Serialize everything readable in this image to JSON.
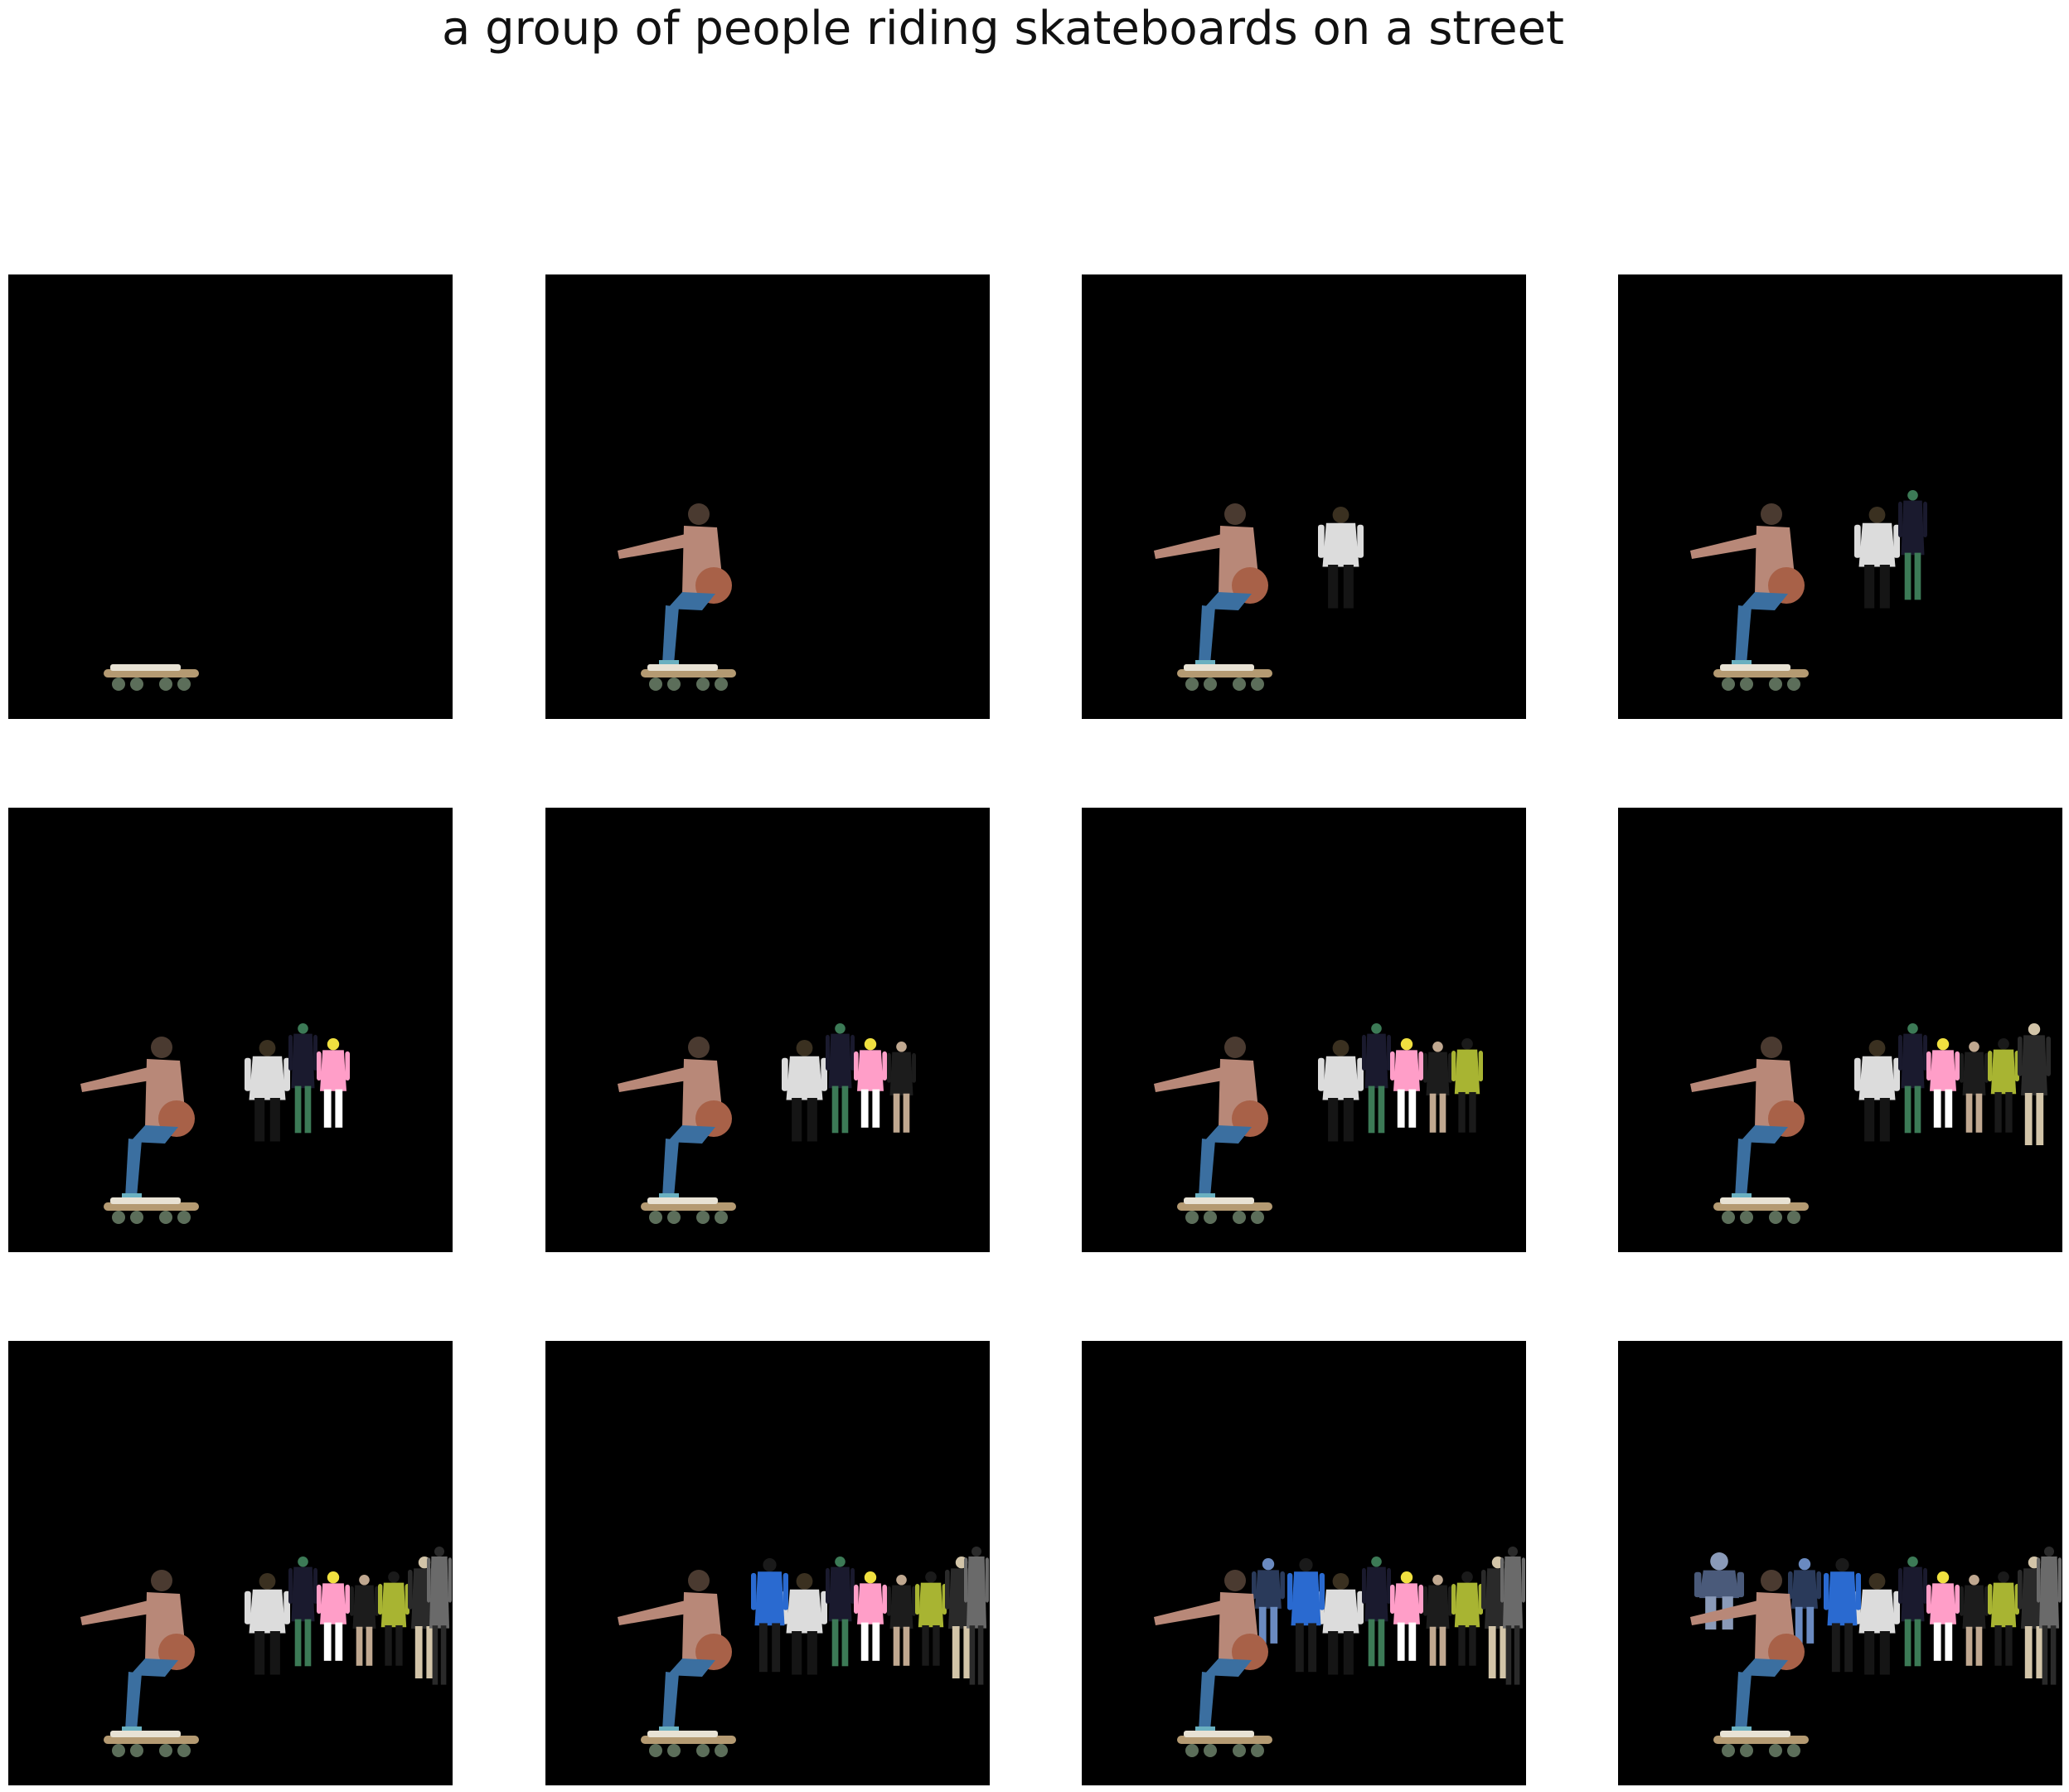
{
  "title": "a group of people riding skateboards on a street",
  "grid": {
    "rows": 3,
    "cols": 4
  },
  "frames": [
    {
      "step": 1,
      "visible_objects": 1
    },
    {
      "step": 2,
      "visible_objects": 2
    },
    {
      "step": 3,
      "visible_objects": 3
    },
    {
      "step": 4,
      "visible_objects": 4
    },
    {
      "step": 5,
      "visible_objects": 5
    },
    {
      "step": 6,
      "visible_objects": 6
    },
    {
      "step": 7,
      "visible_objects": 7
    },
    {
      "step": 8,
      "visible_objects": 8
    },
    {
      "step": 9,
      "visible_objects": 9
    },
    {
      "step": 10,
      "visible_objects": 10
    },
    {
      "step": 11,
      "visible_objects": 11
    },
    {
      "step": 12,
      "visible_objects": 12
    }
  ],
  "objects": [
    {
      "name": "skateboard",
      "colors": [
        "#b49a72",
        "#e8e2d4",
        "#5c6e5a"
      ]
    },
    {
      "name": "crouching-skater",
      "colors": [
        "#b88878",
        "#3b6fa0",
        "#a86148",
        "#4a3a30"
      ]
    },
    {
      "name": "person-white-shirt",
      "colors": [
        "#dcdcdc",
        "#3a3020",
        "#151515"
      ]
    },
    {
      "name": "person-dark-outfit",
      "colors": [
        "#1a1a2e",
        "#3c7a56"
      ]
    },
    {
      "name": "person-pink-yellow",
      "colors": [
        "#ff9ec8",
        "#f0e040",
        "#ffffff"
      ]
    },
    {
      "name": "person-black-jacket",
      "colors": [
        "#1c1c1c",
        "#c0a890"
      ]
    },
    {
      "name": "person-green-jacket",
      "colors": [
        "#a8b432",
        "#1a1a1a"
      ]
    },
    {
      "name": "person-beige-pants",
      "colors": [
        "#2a2a2a",
        "#d2c4a8"
      ]
    },
    {
      "name": "person-gray-coat",
      "colors": [
        "#6a6a6a",
        "#2a2a2a"
      ]
    },
    {
      "name": "person-blue-dress",
      "colors": [
        "#2a6ad0",
        "#1a1a1a"
      ]
    },
    {
      "name": "person-dark-jacket",
      "colors": [
        "#2a3a5a",
        "#6a8ac0"
      ]
    },
    {
      "name": "person-background-left",
      "colors": [
        "#4a5a7a",
        "#8a9ab8"
      ]
    }
  ]
}
